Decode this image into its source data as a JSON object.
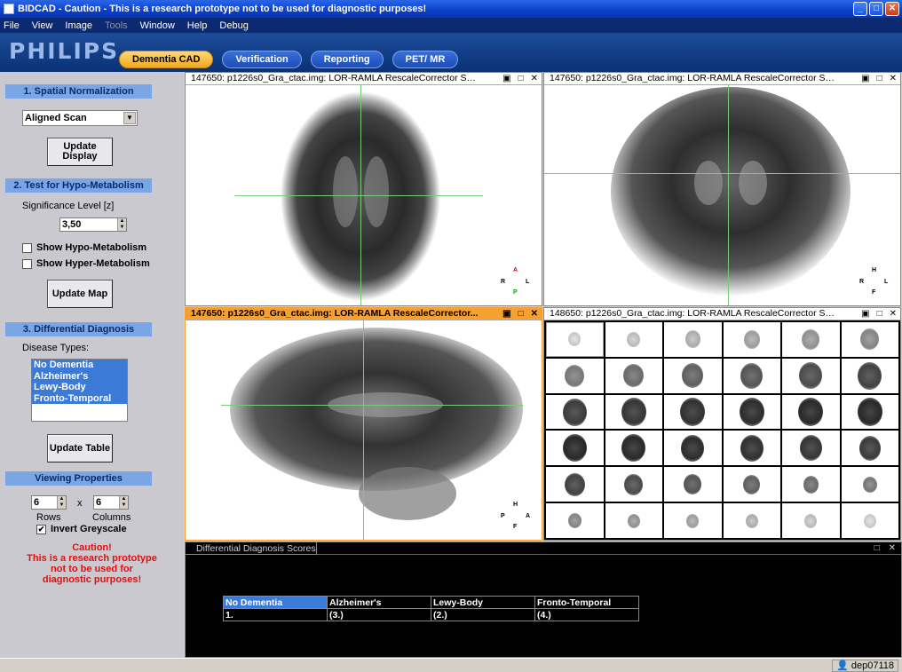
{
  "window": {
    "title": "BIDCAD - Caution - This is a research prototype not to be used for diagnostic purposes!"
  },
  "menu": [
    "File",
    "View",
    "Image",
    "Tools",
    "Window",
    "Help",
    "Debug"
  ],
  "header": {
    "logo": "PHILIPS",
    "tabs": [
      {
        "label": "Dementia CAD",
        "active": true
      },
      {
        "label": "Verification",
        "active": false
      },
      {
        "label": "Reporting",
        "active": false
      },
      {
        "label": "PET/ MR",
        "active": false
      }
    ]
  },
  "sidebar": {
    "s1_title": "1. Spatial Normalization",
    "scan_select": "Aligned Scan",
    "update_display_1": "Update",
    "update_display_2": "Display",
    "s2_title": "2. Test for Hypo-Metabolism",
    "sig_label": "Significance Level [z]",
    "sig_value": "3,50",
    "show_hypo": "Show Hypo-Metabolism",
    "show_hyper": "Show Hyper-Metabolism",
    "update_map": "Update Map",
    "s3_title": "3. Differential Diagnosis",
    "disease_label": "Disease Types:",
    "diseases": [
      "No Dementia",
      "Alzheimer's",
      "Lewy-Body",
      "Fronto-Temporal"
    ],
    "update_table": "Update Table",
    "view_title": "Viewing Properties",
    "rows_value": "6",
    "cols_value": "6",
    "times": "x",
    "rows_label": "Rows",
    "cols_label": "Columns",
    "invert": "Invert Greyscale",
    "caution_1": "Caution!",
    "caution_2": "This is a research prototype",
    "caution_3": "not to be used for",
    "caution_4": "diagnostic purposes!"
  },
  "views": {
    "v1_title": "147650:  p1226s0_Gra_ctac.img:  LOR-RAMLA  RescaleCorrector Sp...",
    "v2_title": "147650:  p1226s0_Gra_ctac.img:  LOR-RAMLA  RescaleCorrector Sp...",
    "v3_title": "147650:  p1226s0_Gra_ctac.img:  LOR-RAMLA  RescaleCorrector...",
    "v4_title": "148650:  p1226s0_Gra_ctac.img:  LOR-RAMLA  RescaleCorrector Sp..."
  },
  "orient": {
    "axial": [
      "A",
      "R",
      "L",
      "P"
    ],
    "coronal": [
      "H",
      "R",
      "L",
      "F"
    ],
    "sagittal": [
      "H",
      "P",
      "A",
      "F"
    ]
  },
  "scores": {
    "tab_label": "Differential Diagnosis Scores",
    "headers": [
      "No Dementia",
      "Alzheimer's",
      "Lewy-Body",
      "Fronto-Temporal"
    ],
    "values": [
      "1.",
      "(3.)",
      "(2.)",
      "(4.)"
    ]
  },
  "status": {
    "user": "dep07118"
  }
}
